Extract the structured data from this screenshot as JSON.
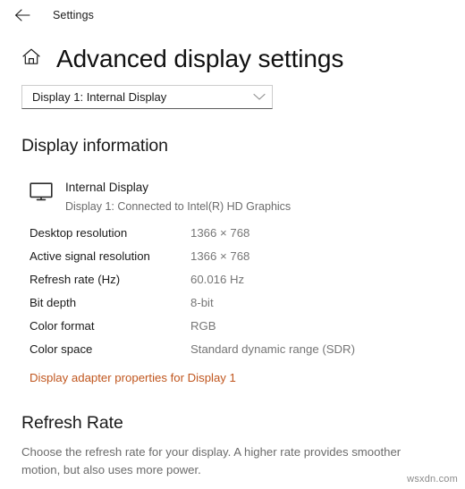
{
  "titlebar": {
    "back_icon": "arrow-left-icon",
    "app_title": "Settings"
  },
  "header": {
    "home_icon": "home-icon",
    "page_title": "Advanced display settings"
  },
  "display_selector": {
    "selected": "Display 1: Internal Display",
    "chevron_icon": "chevron-down-icon",
    "options": [
      "Display 1: Internal Display"
    ]
  },
  "display_information": {
    "section_title": "Display information",
    "monitor_icon": "monitor-icon",
    "monitor_name": "Internal Display",
    "monitor_subtitle": "Display 1: Connected to Intel(R) HD Graphics",
    "specs": [
      {
        "label": "Desktop resolution",
        "value": "1366 × 768"
      },
      {
        "label": "Active signal resolution",
        "value": "1366 × 768"
      },
      {
        "label": "Refresh rate (Hz)",
        "value": "60.016 Hz"
      },
      {
        "label": "Bit depth",
        "value": "8-bit"
      },
      {
        "label": "Color format",
        "value": "RGB"
      },
      {
        "label": "Color space",
        "value": "Standard dynamic range (SDR)"
      }
    ],
    "adapter_link": "Display adapter properties for Display 1"
  },
  "refresh_rate": {
    "section_title": "Refresh Rate",
    "description": "Choose the refresh rate for your display. A higher rate provides smoother motion, but also uses more power."
  },
  "watermark": "wsxdn.com",
  "colors": {
    "link": "#c0561e",
    "text": "#1a1a1a",
    "muted": "#767676",
    "border_bottom": "#5c5c5c"
  }
}
